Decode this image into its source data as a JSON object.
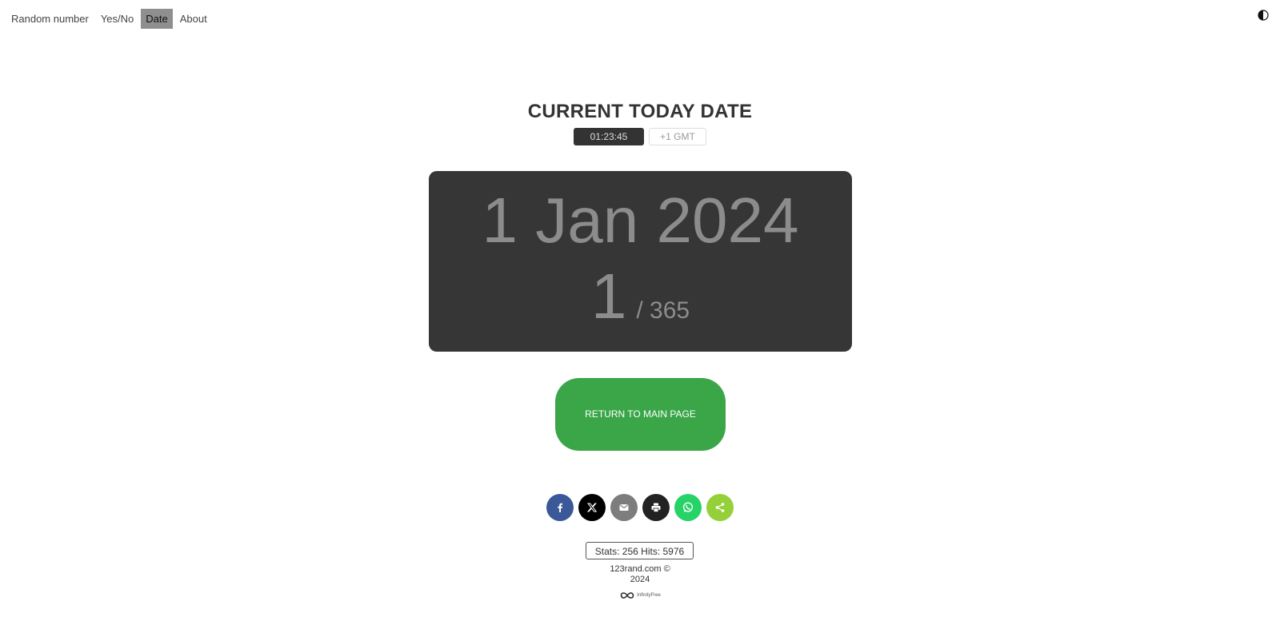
{
  "nav": {
    "items": [
      {
        "label": "Random number",
        "active": false
      },
      {
        "label": "Yes/No",
        "active": false
      },
      {
        "label": "Date",
        "active": true
      },
      {
        "label": "About",
        "active": false
      }
    ],
    "theme_toggle_icon": "contrast-icon"
  },
  "header": {
    "title": "CURRENT TODAY DATE",
    "time": "01:23:45",
    "timezone": "+1 GMT"
  },
  "date_card": {
    "date": "1 Jan 2024",
    "day_of_year": "1",
    "days_total": "/ 365"
  },
  "return_button": {
    "label": "RETURN TO MAIN PAGE",
    "color": "#3aa648"
  },
  "share": {
    "buttons": [
      {
        "name": "facebook",
        "icon": "facebook-icon",
        "color": "#3b5998"
      },
      {
        "name": "x",
        "icon": "x-icon",
        "color": "#000000"
      },
      {
        "name": "email",
        "icon": "email-icon",
        "color": "#7d7d7d"
      },
      {
        "name": "print",
        "icon": "print-icon",
        "color": "#222222"
      },
      {
        "name": "whatsapp",
        "icon": "whatsapp-icon",
        "color": "#25d366"
      },
      {
        "name": "share",
        "icon": "share-icon",
        "color": "#95d03a"
      }
    ]
  },
  "stats": {
    "text": "Stats: 256 Hits: 5976"
  },
  "footer": {
    "site": "123rand.com ©",
    "year": "2024",
    "hosting_label": "InfinityFree"
  }
}
